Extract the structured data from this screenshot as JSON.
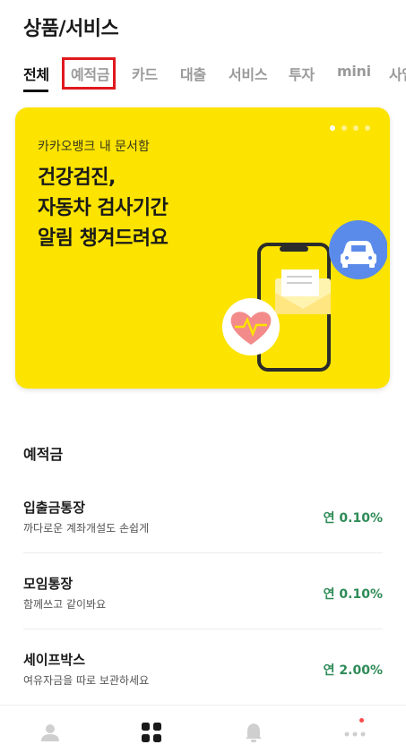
{
  "header": {
    "title": "상품/서비스"
  },
  "tabs": [
    {
      "label": "전체",
      "active": true
    },
    {
      "label": "예적금",
      "active": false,
      "highlighted": true
    },
    {
      "label": "카드",
      "active": false
    },
    {
      "label": "대출",
      "active": false
    },
    {
      "label": "서비스",
      "active": false
    },
    {
      "label": "투자",
      "active": false
    },
    {
      "label": "mini",
      "active": false
    },
    {
      "label": "사업",
      "active": false
    }
  ],
  "banner": {
    "subtitle": "카카오뱅크 내 문서함",
    "headline_line1": "건강검진,",
    "headline_line2": "자동차 검사기간",
    "headline_line3": "알림 챙겨드려요",
    "page_count": 4,
    "current_page": 1,
    "bg_color": "#fce300"
  },
  "section": {
    "title": "예적금"
  },
  "products": [
    {
      "name": "입출금통장",
      "desc": "까다로운 계좌개설도 손쉽게",
      "rate": "연 0.10%"
    },
    {
      "name": "모임통장",
      "desc": "함께쓰고 같이봐요",
      "rate": "연 0.10%"
    },
    {
      "name": "세이프박스",
      "desc": "여유자금을 따로 보관하세요",
      "rate": "연 2.00%"
    }
  ],
  "bottom_nav": [
    {
      "icon": "person-icon",
      "active": false
    },
    {
      "icon": "grid-icon",
      "active": true
    },
    {
      "icon": "bell-icon",
      "active": false
    },
    {
      "icon": "more-icon",
      "active": false,
      "badge": true
    }
  ],
  "colors": {
    "accent_rate": "#2e8b57",
    "highlight_box": "#e0191e",
    "badge": "#ff4b4b"
  }
}
